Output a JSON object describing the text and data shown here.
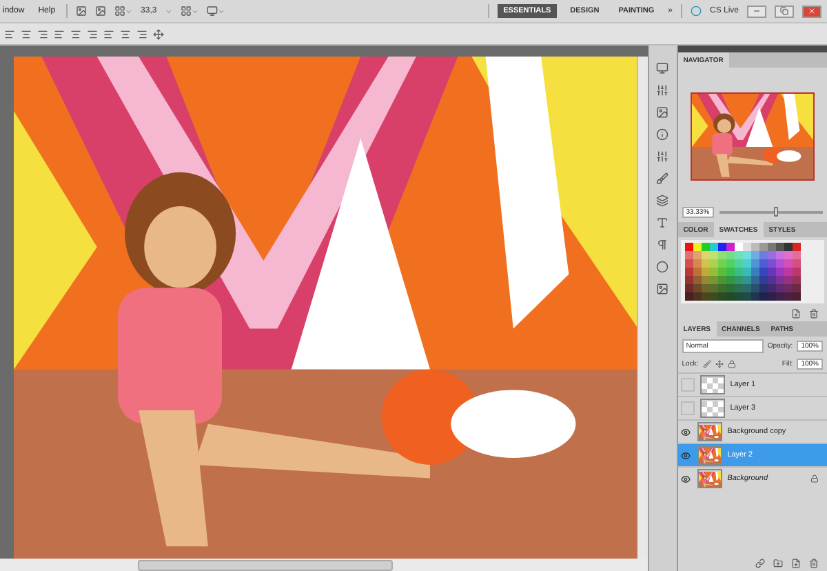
{
  "menu_bar": {
    "menus": [
      "indow",
      "Help"
    ],
    "zoom": "33,3",
    "workspaces": [
      {
        "label": "ESSENTIALS",
        "selected": true
      },
      {
        "label": "DESIGN",
        "selected": false
      },
      {
        "label": "PAINTING",
        "selected": false
      }
    ],
    "more": "»",
    "cs_live": "CS Live"
  },
  "navigator": {
    "title": "NAVIGATOR",
    "zoom": "33.33%",
    "level": 0.55
  },
  "swatches_panel": {
    "tabs": [
      {
        "label": "COLOR",
        "selected": false
      },
      {
        "label": "SWATCHES",
        "selected": true
      },
      {
        "label": "STYLES",
        "selected": false
      }
    ]
  },
  "layers_panel": {
    "tabs": [
      {
        "label": "LAYERS",
        "selected": true
      },
      {
        "label": "CHANNELS",
        "selected": false
      },
      {
        "label": "PATHS",
        "selected": false
      }
    ],
    "blend_mode": "Normal",
    "opacity_label": "Opacity:",
    "opacity": "100%",
    "lock_label": "Lock:",
    "fill_label": "Fill:",
    "fill": "100%",
    "layers": [
      {
        "name": "Layer 1",
        "visible": false,
        "selected": false,
        "locked": false
      },
      {
        "name": "Layer 3",
        "visible": false,
        "selected": false,
        "locked": false
      },
      {
        "name": "Background copy",
        "visible": true,
        "selected": false,
        "locked": false
      },
      {
        "name": "Layer 2",
        "visible": true,
        "selected": true,
        "locked": false
      },
      {
        "name": "Background",
        "visible": true,
        "selected": false,
        "locked": true
      }
    ]
  }
}
